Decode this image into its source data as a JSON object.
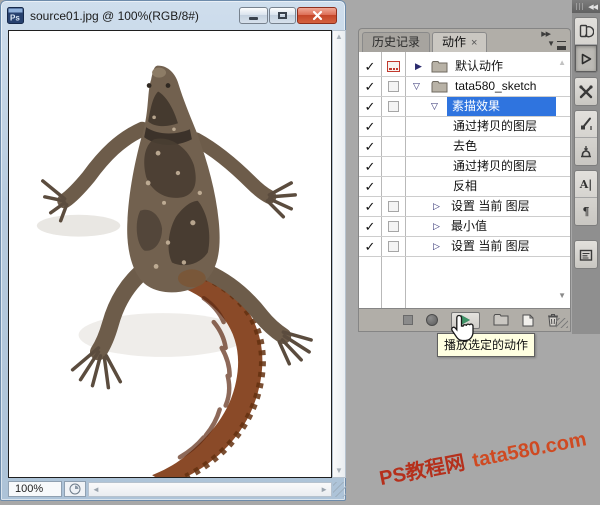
{
  "window": {
    "title": "source01.jpg @ 100%(RGB/8#)",
    "status_zoom": "100%"
  },
  "document": {
    "image": "lizard-top-view-photo"
  },
  "panel": {
    "tabs": [
      {
        "label": "历史记录"
      },
      {
        "label": "动作"
      }
    ],
    "tab_close": "×",
    "actions": [
      {
        "label": "默认动作"
      },
      {
        "label": "tata580_sketch"
      },
      {
        "label": "素描效果"
      },
      {
        "label": "通过拷贝的图层"
      },
      {
        "label": "去色"
      },
      {
        "label": "通过拷贝的图层"
      },
      {
        "label": "反相"
      },
      {
        "label": "设置 当前 图层"
      },
      {
        "label": "最小值"
      },
      {
        "label": "设置 当前 图层"
      }
    ],
    "selected_action": "素描效果",
    "tooltip": "播放选定的动作"
  },
  "icons": {
    "check": "✓",
    "tri_closed": "▶",
    "tri_open": "▽",
    "tri_sub": "▷",
    "arrow_up": "▲",
    "arrow_down": "▼",
    "arrow_left": "◄",
    "arrow_right": "►",
    "panel_collapse": "▶▶",
    "dock_expand": "◀◀",
    "panel_menu_tri": "▼",
    "character_panel": "A|",
    "paragraph_panel": "¶"
  },
  "colors": {
    "selection_blue": "#2f74df",
    "tooltip_yellow": "#ffffe1",
    "play_green": "#3f9468",
    "watermark_red": "#b5301c",
    "close_red": "#c44428"
  },
  "watermark": {
    "part1": "PS教程网",
    "part2": "tata580.com"
  }
}
